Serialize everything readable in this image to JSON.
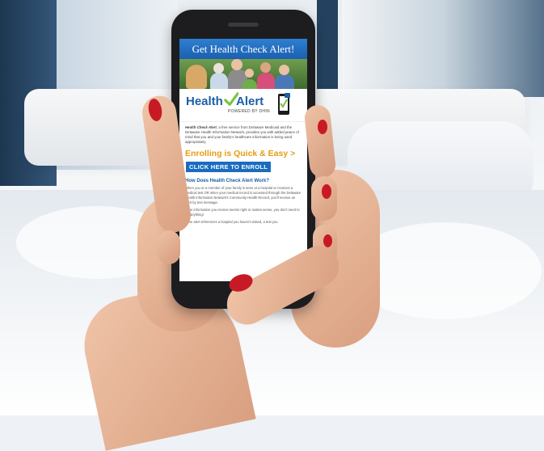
{
  "banner": {
    "title": "Get Health Check Alert!"
  },
  "logo": {
    "word_health": "Health",
    "word_alert": "Alert",
    "powered_by": "POWERED BY DHIN"
  },
  "intro": {
    "lead": "Health Check Alert",
    "text": ", a free service from Delaware Medicaid and the Delaware Health Information Network, provides you with added peace of mind that you and your family's healthcare information is being used appropriately."
  },
  "enroll": {
    "title": "Enrolling is Quick & Easy >",
    "button_label": "CLICK HERE TO ENROLL"
  },
  "how": {
    "title": "How Does Health Check Alert Work?",
    "paragraphs": [
      "When you or a member of your family is seen at a hospital or receives a medical test OR when your medical record is accessed through the Delaware Health Information Network's Community Health Record, you'll receive an alert by text message.",
      "If the information you receive seems right or makes sense, you don't need to do anything!",
      "If the alert references a hospital you haven't visited, a test you"
    ]
  },
  "colors": {
    "banner": "#1b5fb0",
    "logo_blue": "#1b5fa8",
    "check_green": "#7cc242",
    "enroll_orange": "#e59c12",
    "button_blue": "#1a6cc0",
    "nail_red": "#c81a24"
  }
}
